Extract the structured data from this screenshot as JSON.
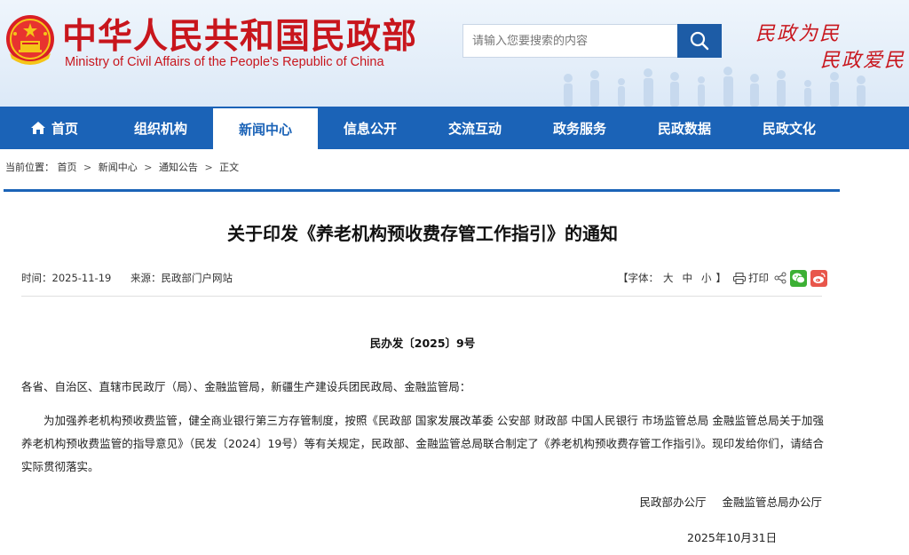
{
  "header": {
    "title_cn": "中华人民共和国民政部",
    "title_en": "Ministry of Civil Affairs of the People's Republic of China",
    "search_placeholder": "请输入您要搜索的内容",
    "slogans": [
      "民政为民",
      "民政爱民"
    ]
  },
  "nav": {
    "items": [
      {
        "label": "首页",
        "icon": "home-icon"
      },
      {
        "label": "组织机构"
      },
      {
        "label": "新闻中心",
        "active": true
      },
      {
        "label": "信息公开"
      },
      {
        "label": "交流互动"
      },
      {
        "label": "政务服务"
      },
      {
        "label": "民政数据"
      },
      {
        "label": "民政文化"
      }
    ]
  },
  "breadcrumb": {
    "prefix": "当前位置：",
    "items": [
      "首页",
      "新闻中心",
      "通知公告",
      "正文"
    ],
    "separator": ">"
  },
  "article": {
    "title": "关于印发《养老机构预收费存管工作指引》的通知",
    "time": "时间：2025-11-19",
    "source": "来源：民政部门户网站",
    "font_size_label": "【字体：",
    "font_sizes": [
      "大",
      "中",
      "小"
    ],
    "font_size_close": "】",
    "print_label": "打印",
    "doc_number": "民办发〔2025〕9号",
    "addressee": "各省、自治区、直辖市民政厅（局）、金融监管局，新疆生产建设兵团民政局、金融监管局：",
    "body": "为加强养老机构预收费监管，健全商业银行第三方存管制度，按照《民政部 国家发展改革委 公安部 财政部 中国人民银行 市场监管总局 金融监管总局关于加强养老机构预收费监管的指导意见》（民发〔2024〕19号）等有关规定，民政部、金融监管总局联合制定了《养老机构预收费存管工作指引》。现印发给你们，请结合实际贯彻落实。",
    "signers": [
      "民政部办公厅",
      "金融监管总局办公厅"
    ],
    "date": "2025年10月31日"
  },
  "colors": {
    "brand_red": "#c8161d",
    "nav_blue": "#1b63b7",
    "search_button": "#1d5ca6",
    "wechat_green": "#3cb034",
    "weibo_red": "#e8564b"
  }
}
